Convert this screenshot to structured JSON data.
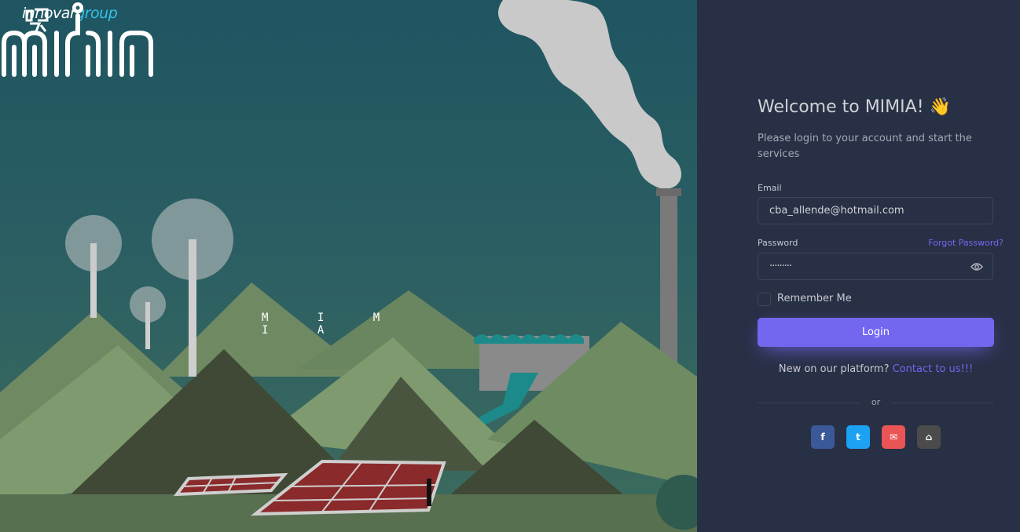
{
  "brand": {
    "name_part1": "innovar",
    "name_part2": "group"
  },
  "logo": {
    "wordmark": "M I M I A"
  },
  "login": {
    "title": "Welcome to MIMIA! 👋",
    "subtitle": "Please login to your account and start the services",
    "email_label": "Email",
    "email_value": "cba_allende@hotmail.com",
    "password_label": "Password",
    "forgot_label": "Forgot Password?",
    "password_value": "·········",
    "remember_label": "Remember Me",
    "login_button": "Login",
    "new_text": "New on our platform?",
    "contact_link": "Contact to us!!!",
    "divider_text": "or"
  },
  "social": [
    {
      "name": "facebook",
      "glyph": "f",
      "color": "#3b5998"
    },
    {
      "name": "twitter",
      "glyph": "t",
      "color": "#1da1f2"
    },
    {
      "name": "mail",
      "glyph": "✉",
      "color": "#ea5455"
    },
    {
      "name": "github",
      "glyph": "⌂",
      "color": "#4b4b4b"
    }
  ],
  "colors": {
    "primary": "#7367f0",
    "panel": "#283046"
  }
}
